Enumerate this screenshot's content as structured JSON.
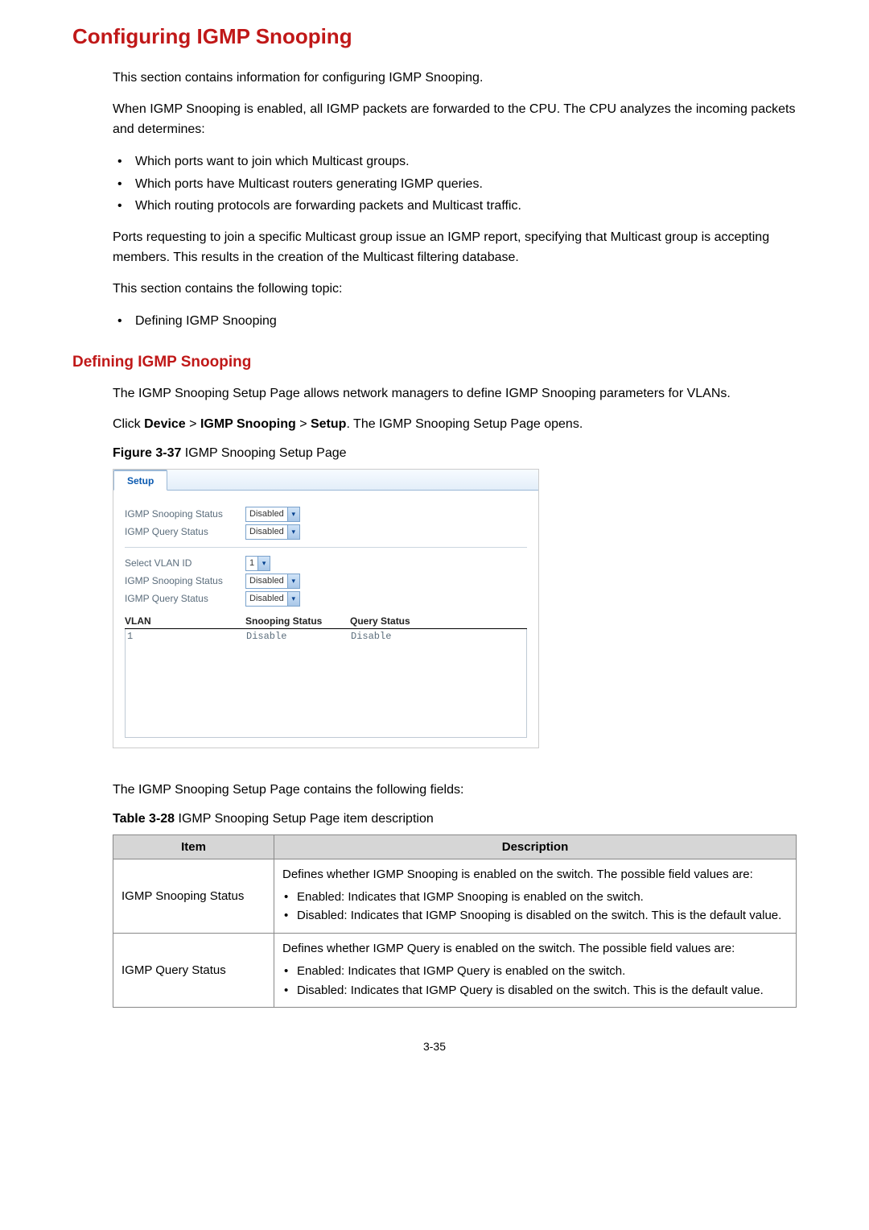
{
  "title": "Configuring IGMP Snooping",
  "intro1": "This section contains information for configuring IGMP Snooping.",
  "intro2": "When IGMP Snooping is enabled, all IGMP packets are forwarded to the CPU. The CPU analyzes the incoming packets and determines:",
  "bulletsA": [
    "Which ports want to join which Multicast groups.",
    "Which ports have Multicast routers generating IGMP queries.",
    "Which routing protocols are forwarding packets and Multicast traffic."
  ],
  "intro3": "Ports requesting to join a specific Multicast group issue an IGMP report, specifying that Multicast group is accepting members. This results in the creation of the Multicast filtering database.",
  "intro4": "This section contains the following topic:",
  "bulletsB": [
    "Defining IGMP Snooping"
  ],
  "subTitle": "Defining IGMP Snooping",
  "sub1": "The IGMP Snooping Setup Page allows network managers to define IGMP Snooping parameters for VLANs.",
  "sub2a": "Click ",
  "sub2b": "Device",
  "sub2c": " > ",
  "sub2d": "IGMP Snooping",
  "sub2e": " > ",
  "sub2f": "Setup",
  "sub2g": ". The IGMP Snooping Setup Page opens.",
  "figCapBold": "Figure 3-37",
  "figCapRest": " IGMP Snooping Setup Page",
  "panel": {
    "tab": "Setup",
    "rows1": [
      {
        "label": "IGMP Snooping Status",
        "value": "Disabled"
      },
      {
        "label": "IGMP Query Status",
        "value": "Disabled"
      }
    ],
    "rows2": [
      {
        "label": "Select VLAN ID",
        "value": "1"
      },
      {
        "label": "IGMP Snooping Status",
        "value": "Disabled"
      },
      {
        "label": "IGMP Query Status",
        "value": "Disabled"
      }
    ],
    "gridHeaders": [
      "VLAN",
      "Snooping Status",
      "Query Status"
    ],
    "gridRow": [
      "1",
      "Disable",
      "Disable"
    ]
  },
  "afterFig": "The IGMP Snooping Setup Page contains the following fields:",
  "tblCapBold": "Table 3-28",
  "tblCapRest": " IGMP Snooping Setup Page item description",
  "table": {
    "headItem": "Item",
    "headDesc": "Description",
    "rows": [
      {
        "item": "IGMP Snooping Status",
        "desc": "Defines whether IGMP Snooping is enabled on the switch. The possible field values are:",
        "list": [
          "Enabled: Indicates that IGMP Snooping is enabled on the switch.",
          "Disabled: Indicates that IGMP Snooping is disabled on the switch. This is the default value."
        ]
      },
      {
        "item": "IGMP Query Status",
        "desc": "Defines whether IGMP Query is enabled on the switch. The possible field values are:",
        "list": [
          "Enabled: Indicates that IGMP Query is enabled on the switch.",
          "Disabled: Indicates that IGMP Query is disabled on the switch. This is the default value."
        ]
      }
    ]
  },
  "pageNum": "3-35"
}
